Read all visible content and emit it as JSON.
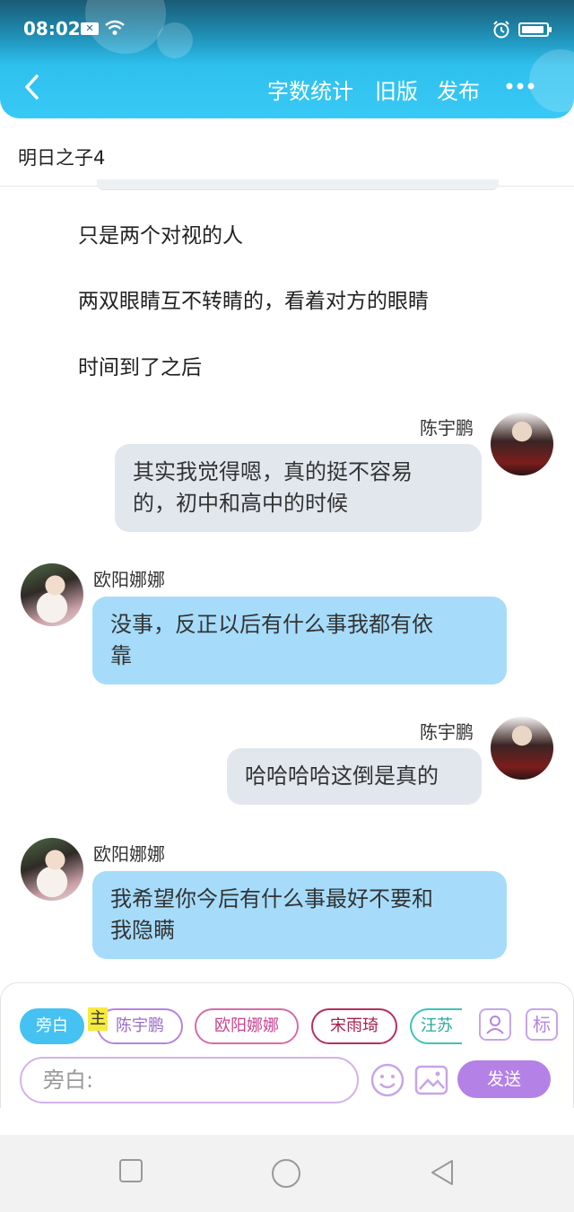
{
  "status": {
    "time": "08:02"
  },
  "header": {
    "actions": {
      "word_count": "字数统计",
      "old_version": "旧版",
      "publish": "发布"
    }
  },
  "document": {
    "title": "明日之子4"
  },
  "narration": [
    "只是两个对视的人",
    "两双眼睛互不转睛的，看着对方的眼睛",
    "时间到了之后"
  ],
  "messages": [
    {
      "speaker": "陈宇鹏",
      "line1": "其实我觉得嗯，真的挺不容易",
      "line2": "的，初中和高中的时候"
    },
    {
      "speaker": "欧阳娜娜",
      "line1": "没事，反正以后有什么事我都有依",
      "line2": "靠"
    },
    {
      "speaker": "陈宇鹏",
      "line1": "哈哈哈哈这倒是真的"
    },
    {
      "speaker": "欧阳娜娜",
      "line1": "我希望你今后有什么事最好不要和",
      "line2": "我隐瞒"
    }
  ],
  "composer": {
    "chips": [
      "旁白",
      "陈宇鹏",
      "欧阳娜娜",
      "宋雨琦",
      "汪苏"
    ],
    "main_tag": "主",
    "tag_icon_label": "标",
    "input_placeholder": "旁白:",
    "send_label": "发送"
  },
  "colors": {
    "header_accent": "#39c9f5",
    "bubble_gray": "#e2e7ee",
    "bubble_blue": "#a6dcfa",
    "send_purple": "#b481e6"
  }
}
